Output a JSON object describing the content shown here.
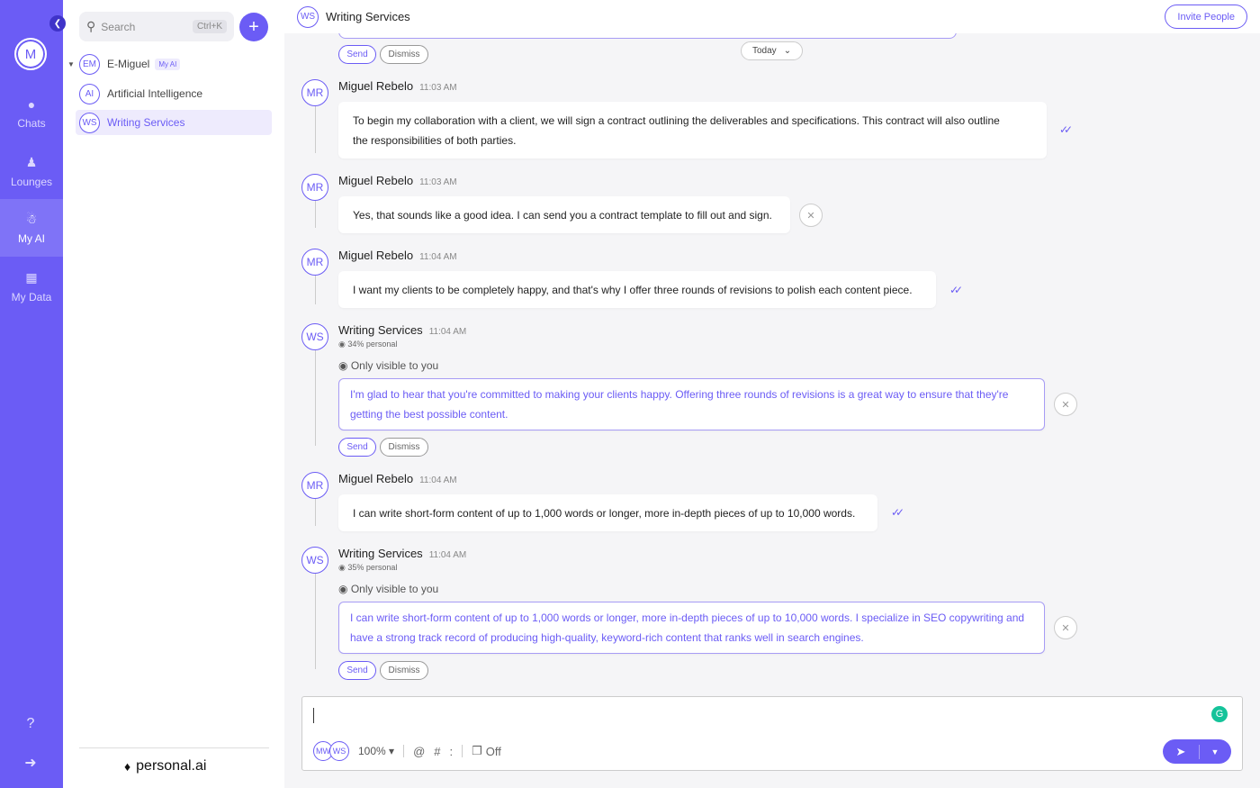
{
  "rail": {
    "avatar_initial": "M",
    "items": [
      {
        "label": "Chats",
        "icon": "chats-icon"
      },
      {
        "label": "Lounges",
        "icon": "lounges-icon"
      },
      {
        "label": "My AI",
        "icon": "my-ai-icon"
      },
      {
        "label": "My Data",
        "icon": "my-data-icon"
      }
    ],
    "accent": "#6b5cf5"
  },
  "sidebar": {
    "search_placeholder": "Search",
    "search_shortcut": "Ctrl+K",
    "items": [
      {
        "initials": "EM",
        "label": "E-Miguel",
        "badge": "My AI"
      },
      {
        "initials": "AI",
        "label": "Artificial Intelligence"
      },
      {
        "initials": "WS",
        "label": "Writing Services"
      }
    ],
    "brand": "personal.ai"
  },
  "header": {
    "initials": "WS",
    "title": "Writing Services",
    "invite_label": "Invite People"
  },
  "date_divider": "Today",
  "actions": {
    "send": "Send",
    "dismiss": "Dismiss"
  },
  "messages": [
    {
      "initials": "MR",
      "sender": "Miguel Rebelo",
      "time": "11:03 AM",
      "line1": "To begin my collaboration with a client, we will sign a contract outlining the deliverables and specifications. This contract will also outline",
      "line2": "the responsibilities of both parties."
    },
    {
      "initials": "MR",
      "sender": "Miguel Rebelo",
      "time": "11:03 AM",
      "line1": "Yes, that sounds like a good idea. I can send you a contract template to fill out and sign."
    },
    {
      "initials": "MR",
      "sender": "Miguel Rebelo",
      "time": "11:04 AM",
      "line1": "I want my clients to be completely happy, and that's why I offer three rounds of revisions to polish each content piece."
    },
    {
      "initials": "WS",
      "sender": "Writing Services",
      "time": "11:04 AM",
      "personal": "34% personal",
      "visibility": "Only visible to you",
      "line1": "I'm glad to hear that you're committed to making your clients happy. Offering three rounds of revisions is a great way to ensure that they're",
      "line2": "getting the best possible content."
    },
    {
      "initials": "MR",
      "sender": "Miguel Rebelo",
      "time": "11:04 AM",
      "line1": "I can write short-form content of up to 1,000 words or longer, more in-depth pieces of up to 10,000 words."
    },
    {
      "initials": "WS",
      "sender": "Writing Services",
      "time": "11:04 AM",
      "personal": "35% personal",
      "visibility": "Only visible to you",
      "line1": "I can write short-form content of up to 1,000 words or longer, more in-depth pieces of up to 10,000 words. I specialize in SEO copywriting and",
      "line2": "have a strong track record of producing high-quality, keyword-rich content that ranks well in search engines."
    }
  ],
  "composer": {
    "participants": [
      "MW",
      "WS"
    ],
    "zoom": "100%",
    "tools": [
      "@",
      "#",
      ":"
    ],
    "mode_label": "Off"
  }
}
